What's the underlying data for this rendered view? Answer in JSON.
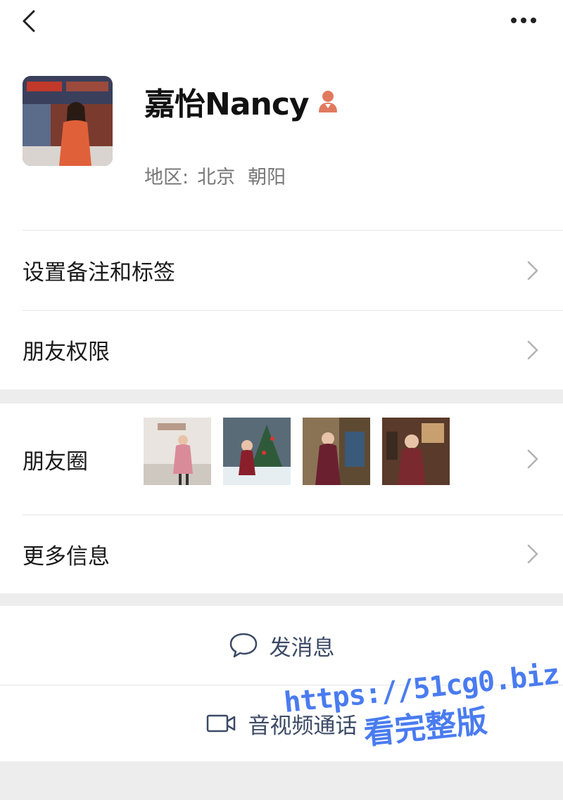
{
  "profile": {
    "name": "嘉怡Nancy",
    "region_label": "地区:",
    "region_city": "北京",
    "region_district": "朝阳"
  },
  "menu": {
    "set_remark": "设置备注和标签",
    "friend_permission": "朋友权限",
    "moments": "朋友圈",
    "more_info": "更多信息"
  },
  "actions": {
    "message": "发消息",
    "video_call": "音视频通话"
  },
  "watermark": {
    "url": "https://51cg0.biz",
    "text": "看完整版"
  },
  "colors": {
    "accent_text": "#3c4a66",
    "gender_icon": "#e07a5f",
    "watermark": "#4a7cf0"
  },
  "icons": {
    "back": "chevron-left-icon",
    "more": "ellipsis-icon",
    "gender": "female-icon",
    "row_arrow": "chevron-right-icon",
    "message": "chat-bubble-icon",
    "video": "video-camera-icon"
  }
}
